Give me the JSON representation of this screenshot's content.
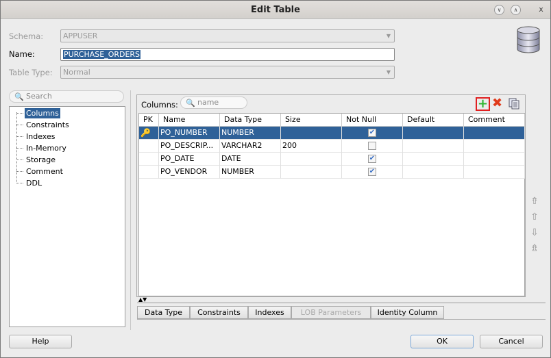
{
  "window": {
    "title": "Edit Table"
  },
  "form": {
    "schema_label": "Schema:",
    "schema_value": "APPUSER",
    "name_label": "Name:",
    "name_value": "PURCHASE_ORDERS",
    "table_type_label": "Table Type:",
    "table_type_value": "Normal"
  },
  "sidebar": {
    "search_placeholder": "Search",
    "items": [
      {
        "label": "Columns",
        "selected": true
      },
      {
        "label": "Constraints"
      },
      {
        "label": "Indexes"
      },
      {
        "label": "In-Memory"
      },
      {
        "label": "Storage"
      },
      {
        "label": "Comment"
      },
      {
        "label": "DDL"
      }
    ]
  },
  "columns_panel": {
    "label": "Columns:",
    "filter_placeholder": "name",
    "headers": [
      "PK",
      "Name",
      "Data Type",
      "Size",
      "Not Null",
      "Default",
      "Comment"
    ],
    "rows": [
      {
        "pk": true,
        "name": "PO_NUMBER",
        "type": "NUMBER",
        "size": "",
        "not_null": true,
        "default": "",
        "comment": "",
        "selected": true
      },
      {
        "pk": false,
        "name": "PO_DESCRIP...",
        "type": "VARCHAR2",
        "size": "200",
        "not_null": false,
        "default": "",
        "comment": ""
      },
      {
        "pk": false,
        "name": "PO_DATE",
        "type": "DATE",
        "size": "",
        "not_null": true,
        "default": "",
        "comment": ""
      },
      {
        "pk": false,
        "name": "PO_VENDOR",
        "type": "NUMBER",
        "size": "",
        "not_null": true,
        "default": "",
        "comment": ""
      }
    ]
  },
  "bottom_tabs": [
    "Data Type",
    "Constraints",
    "Indexes",
    "LOB Parameters",
    "Identity Column"
  ],
  "buttons": {
    "help": "Help",
    "ok": "OK",
    "cancel": "Cancel"
  },
  "colors": {
    "selection": "#2f6198",
    "add_highlight": "#e02020"
  }
}
